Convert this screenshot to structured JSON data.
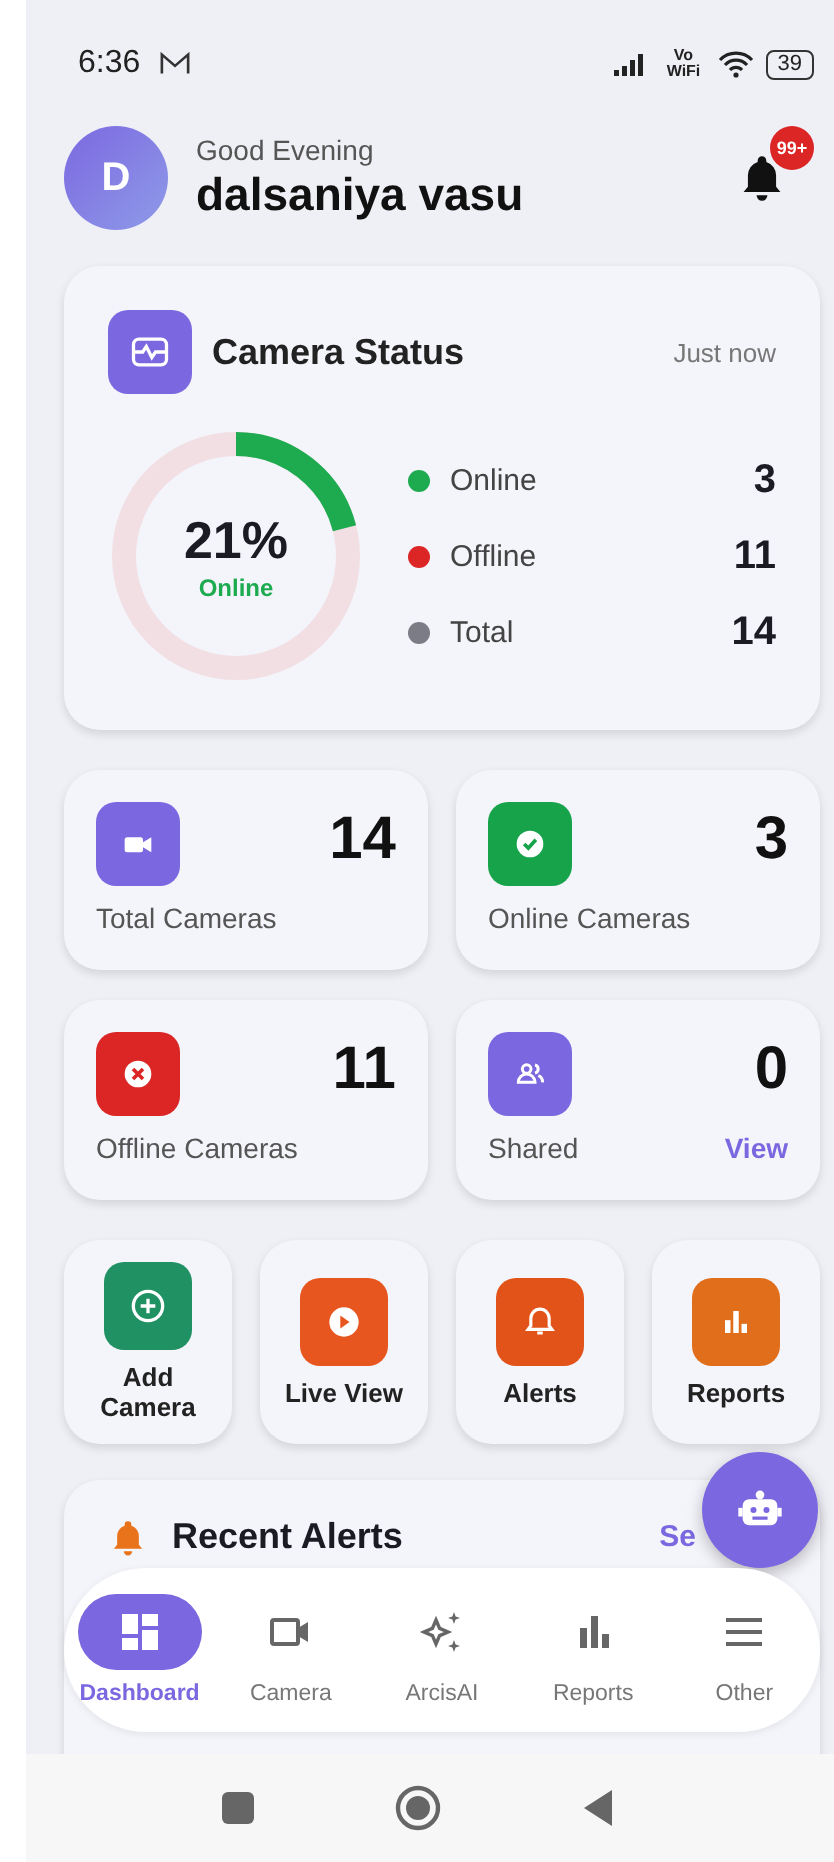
{
  "status_bar": {
    "time": "6:36",
    "network_label": "Vo WiFi",
    "battery": "39"
  },
  "header": {
    "avatar_initial": "D",
    "greeting": "Good Evening",
    "name": "dalsaniya vasu",
    "notification_badge": "99+"
  },
  "camera_status": {
    "title": "Camera Status",
    "updated": "Just now",
    "ring": {
      "level": 0.21,
      "percent": "21%",
      "caption": "Online"
    },
    "legend": [
      {
        "label": "Online",
        "value": "3",
        "color": "#1eab4f"
      },
      {
        "label": "Offline",
        "value": "11",
        "color": "#dc2626"
      },
      {
        "label": "Total",
        "value": "14",
        "color": "#7c7c86"
      }
    ]
  },
  "stats": [
    {
      "kind": "video",
      "value": "14",
      "label": "Total Cameras",
      "color": "#7b68e0"
    },
    {
      "kind": "check",
      "value": "3",
      "label": "Online Cameras",
      "color": "#16a34a"
    },
    {
      "kind": "cross",
      "value": "11",
      "label": "Offline Cameras",
      "color": "#dc2626"
    },
    {
      "kind": "people",
      "value": "0",
      "label": "Shared",
      "color": "#7b68e0",
      "link": "View"
    }
  ],
  "quick_actions": [
    {
      "kind": "add",
      "label": "Add Camera",
      "color": "#1f9163"
    },
    {
      "kind": "play",
      "label": "Live View",
      "color": "#e8561f"
    },
    {
      "kind": "bell",
      "label": "Alerts",
      "color": "#e2531a"
    },
    {
      "kind": "chart",
      "label": "Reports",
      "color": "#e06e1a"
    }
  ],
  "recent_alerts": {
    "title": "Recent Alerts",
    "link": "Se"
  },
  "bottom_nav": [
    {
      "kind": "dashboard",
      "label": "Dashboard",
      "selected": true
    },
    {
      "kind": "camera",
      "label": "Camera",
      "selected": false
    },
    {
      "kind": "sparkle",
      "label": "ArcisAI",
      "selected": false
    },
    {
      "kind": "chart",
      "label": "Reports",
      "selected": false
    },
    {
      "kind": "menu",
      "label": "Other",
      "selected": false
    }
  ]
}
